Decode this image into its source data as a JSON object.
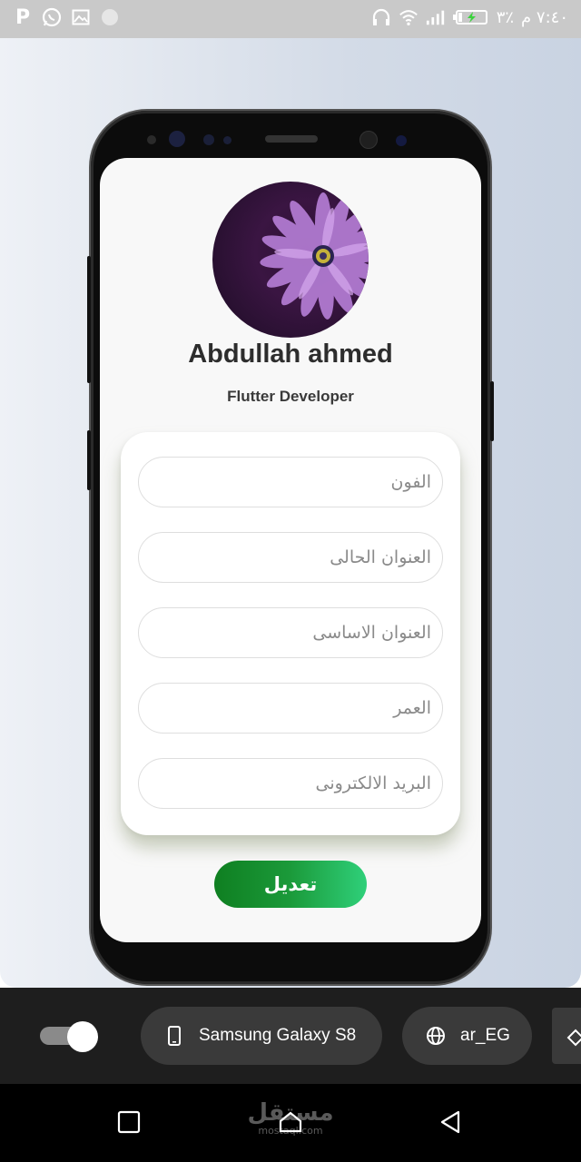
{
  "status_bar": {
    "left_icons": [
      "p-app-icon",
      "whatsapp-icon",
      "gallery-icon",
      "circle-icon"
    ],
    "clock": "٧:٤٠ م",
    "battery_percent": "٣٪",
    "right_icons": [
      "headphones-icon",
      "wifi-icon",
      "signal-icon",
      "battery-charging-icon"
    ]
  },
  "profile": {
    "name": "Abdullah ahmed",
    "role": "Flutter Developer",
    "avatar": "purple-flower-image"
  },
  "form": {
    "fields": [
      {
        "placeholder": "الفون",
        "value": ""
      },
      {
        "placeholder": "العنوان الحالى",
        "value": ""
      },
      {
        "placeholder": "العنوان الاساسى",
        "value": ""
      },
      {
        "placeholder": "العمر",
        "value": ""
      },
      {
        "placeholder": "البريد الالكترونى",
        "value": ""
      }
    ],
    "submit_label": "تعديل"
  },
  "toolbar": {
    "toggle_on": true,
    "device_label": "Samsung Galaxy S8",
    "device_icon": "phone-icon",
    "locale_label": "ar_EG",
    "locale_icon": "globe-icon"
  },
  "nav": {
    "watermark_top": "مستقل",
    "watermark_bottom": "mostaql.com"
  },
  "colors": {
    "button_start": "#0f7f21",
    "button_end": "#2fd07a",
    "status_bar": "#c9c9c9",
    "toolbar": "#1e1e1e"
  }
}
